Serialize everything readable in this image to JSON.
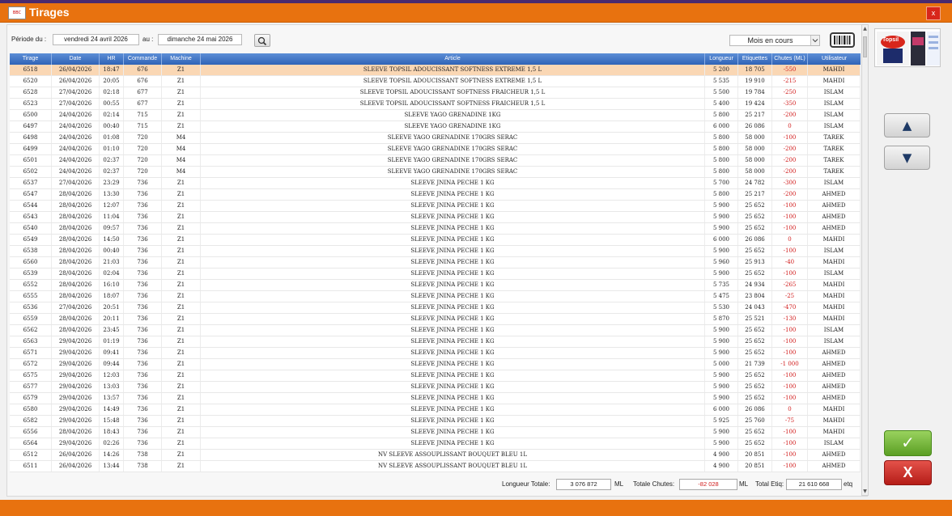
{
  "window": {
    "title": "Tirages",
    "close_label": "x",
    "logo_text": "BBC"
  },
  "filters": {
    "periode_label": "Période du :",
    "date_from": "vendredi 24 avril 2026",
    "au_label": "au :",
    "date_to": "dimanche 24 mai 2026",
    "period_select": "Mois en cours"
  },
  "table": {
    "columns": [
      "Tirage",
      "Date",
      "HR",
      "Commande",
      "Machine",
      "Article",
      "Longueur",
      "Etiquettes",
      "Chutes (ML)",
      "Utilisateur"
    ],
    "rows": [
      [
        "6518",
        "26/04/2026",
        "18:47",
        "676",
        "Z1",
        "SLEEVE TOPSIL ADOUCISSANT SOFTNESS EXTREME 1,5 L",
        "5 200",
        "18 705",
        "-550",
        "MAHDI"
      ],
      [
        "6520",
        "26/04/2026",
        "20:05",
        "676",
        "Z1",
        "SLEEVE TOPSIL ADOUCISSANT SOFTNESS EXTREME 1,5 L",
        "5 535",
        "19 910",
        "-215",
        "MAHDI"
      ],
      [
        "6528",
        "27/04/2026",
        "02:18",
        "677",
        "Z1",
        "SLEEVE TOPSIL ADOUCISSANT SOFTNESS FRAICHEUR 1,5 L",
        "5 500",
        "19 784",
        "-250",
        "ISLAM"
      ],
      [
        "6523",
        "27/04/2026",
        "00:55",
        "677",
        "Z1",
        "SLEEVE TOPSIL ADOUCISSANT SOFTNESS FRAICHEUR 1,5 L",
        "5 400",
        "19 424",
        "-350",
        "ISLAM"
      ],
      [
        "6500",
        "24/04/2026",
        "02:14",
        "715",
        "Z1",
        "SLEEVE YAGO GRENADINE 1KG",
        "5 800",
        "25 217",
        "-200",
        "ISLAM"
      ],
      [
        "6497",
        "24/04/2026",
        "00:40",
        "715",
        "Z1",
        "SLEEVE YAGO GRENADINE 1KG",
        "6 000",
        "26 086",
        "0",
        "ISLAM"
      ],
      [
        "6498",
        "24/04/2026",
        "01:08",
        "720",
        "M4",
        "SLEEVE YAGO GRENADINE 170GRS SERAC",
        "5 800",
        "58 000",
        "-100",
        "TAREK"
      ],
      [
        "6499",
        "24/04/2026",
        "01:10",
        "720",
        "M4",
        "SLEEVE YAGO GRENADINE 170GRS SERAC",
        "5 800",
        "58 000",
        "-200",
        "TAREK"
      ],
      [
        "6501",
        "24/04/2026",
        "02:37",
        "720",
        "M4",
        "SLEEVE YAGO GRENADINE 170GRS SERAC",
        "5 800",
        "58 000",
        "-200",
        "TAREK"
      ],
      [
        "6502",
        "24/04/2026",
        "02:37",
        "720",
        "M4",
        "SLEEVE YAGO GRENADINE 170GRS SERAC",
        "5 800",
        "58 000",
        "-200",
        "TAREK"
      ],
      [
        "6537",
        "27/04/2026",
        "23:29",
        "736",
        "Z1",
        "SLEEVE JNINA PECHE 1 KG",
        "5 700",
        "24 782",
        "-300",
        "ISLAM"
      ],
      [
        "6547",
        "28/04/2026",
        "13:30",
        "736",
        "Z1",
        "SLEEVE JNINA PECHE 1 KG",
        "5 800",
        "25 217",
        "-200",
        "AHMED"
      ],
      [
        "6544",
        "28/04/2026",
        "12:07",
        "736",
        "Z1",
        "SLEEVE JNINA PECHE 1 KG",
        "5 900",
        "25 652",
        "-100",
        "AHMED"
      ],
      [
        "6543",
        "28/04/2026",
        "11:04",
        "736",
        "Z1",
        "SLEEVE JNINA PECHE 1 KG",
        "5 900",
        "25 652",
        "-100",
        "AHMED"
      ],
      [
        "6540",
        "28/04/2026",
        "09:57",
        "736",
        "Z1",
        "SLEEVE JNINA PECHE 1 KG",
        "5 900",
        "25 652",
        "-100",
        "AHMED"
      ],
      [
        "6549",
        "28/04/2026",
        "14:50",
        "736",
        "Z1",
        "SLEEVE JNINA PECHE 1 KG",
        "6 000",
        "26 086",
        "0",
        "MAHDI"
      ],
      [
        "6538",
        "28/04/2026",
        "00:40",
        "736",
        "Z1",
        "SLEEVE JNINA PECHE 1 KG",
        "5 900",
        "25 652",
        "-100",
        "ISLAM"
      ],
      [
        "6560",
        "28/04/2026",
        "21:03",
        "736",
        "Z1",
        "SLEEVE JNINA PECHE 1 KG",
        "5 960",
        "25 913",
        "-40",
        "MAHDI"
      ],
      [
        "6539",
        "28/04/2026",
        "02:04",
        "736",
        "Z1",
        "SLEEVE JNINA PECHE 1 KG",
        "5 900",
        "25 652",
        "-100",
        "ISLAM"
      ],
      [
        "6552",
        "28/04/2026",
        "16:10",
        "736",
        "Z1",
        "SLEEVE JNINA PECHE 1 KG",
        "5 735",
        "24 934",
        "-265",
        "MAHDI"
      ],
      [
        "6555",
        "28/04/2026",
        "18:07",
        "736",
        "Z1",
        "SLEEVE JNINA PECHE 1 KG",
        "5 475",
        "23 804",
        "-25",
        "MAHDI"
      ],
      [
        "6536",
        "27/04/2026",
        "20:51",
        "736",
        "Z1",
        "SLEEVE JNINA PECHE 1 KG",
        "5 530",
        "24 043",
        "-470",
        "MAHDI"
      ],
      [
        "6559",
        "28/04/2026",
        "20:11",
        "736",
        "Z1",
        "SLEEVE JNINA PECHE 1 KG",
        "5 870",
        "25 521",
        "-130",
        "MAHDI"
      ],
      [
        "6562",
        "28/04/2026",
        "23:45",
        "736",
        "Z1",
        "SLEEVE JNINA PECHE 1 KG",
        "5 900",
        "25 652",
        "-100",
        "ISLAM"
      ],
      [
        "6563",
        "29/04/2026",
        "01:19",
        "736",
        "Z1",
        "SLEEVE JNINA PECHE 1 KG",
        "5 900",
        "25 652",
        "-100",
        "ISLAM"
      ],
      [
        "6571",
        "29/04/2026",
        "09:41",
        "736",
        "Z1",
        "SLEEVE JNINA PECHE 1 KG",
        "5 900",
        "25 652",
        "-100",
        "AHMED"
      ],
      [
        "6572",
        "29/04/2026",
        "09:44",
        "736",
        "Z1",
        "SLEEVE JNINA PECHE 1 KG",
        "5 000",
        "21 739",
        "-1 000",
        "AHMED"
      ],
      [
        "6575",
        "29/04/2026",
        "12:03",
        "736",
        "Z1",
        "SLEEVE JNINA PECHE 1 KG",
        "5 900",
        "25 652",
        "-100",
        "AHMED"
      ],
      [
        "6577",
        "29/04/2026",
        "13:03",
        "736",
        "Z1",
        "SLEEVE JNINA PECHE 1 KG",
        "5 900",
        "25 652",
        "-100",
        "AHMED"
      ],
      [
        "6579",
        "29/04/2026",
        "13:57",
        "736",
        "Z1",
        "SLEEVE JNINA PECHE 1 KG",
        "5 900",
        "25 652",
        "-100",
        "AHMED"
      ],
      [
        "6580",
        "29/04/2026",
        "14:49",
        "736",
        "Z1",
        "SLEEVE JNINA PECHE 1 KG",
        "6 000",
        "26 086",
        "0",
        "MAHDI"
      ],
      [
        "6582",
        "29/04/2026",
        "15:48",
        "736",
        "Z1",
        "SLEEVE JNINA PECHE 1 KG",
        "5 925",
        "25 760",
        "-75",
        "MAHDI"
      ],
      [
        "6556",
        "28/04/2026",
        "18:43",
        "736",
        "Z1",
        "SLEEVE JNINA PECHE 1 KG",
        "5 900",
        "25 652",
        "-100",
        "MAHDI"
      ],
      [
        "6564",
        "29/04/2026",
        "02:26",
        "736",
        "Z1",
        "SLEEVE JNINA PECHE 1 KG",
        "5 900",
        "25 652",
        "-100",
        "ISLAM"
      ],
      [
        "6512",
        "26/04/2026",
        "14:26",
        "738",
        "Z1",
        "NV SLEEVE ASSOUPLISSANT BOUQUET BLEU 1L",
        "4 900",
        "20 851",
        "-100",
        "AHMED"
      ],
      [
        "6511",
        "26/04/2026",
        "13:44",
        "738",
        "Z1",
        "NV SLEEVE ASSOUPLISSANT BOUQUET BLEU 1L",
        "4 900",
        "20 851",
        "-100",
        "AHMED"
      ]
    ]
  },
  "totals": {
    "longueur_label": "Longueur Totale:",
    "longueur_value": "3 076 872",
    "longueur_unit": "ML",
    "chutes_label": "Totale Chutes:",
    "chutes_value": "-82 028",
    "chutes_unit": "ML",
    "etiq_label": "Total Etiq:",
    "etiq_value": "21 610 668",
    "etiq_unit": "etq"
  },
  "side": {
    "thumbnail_text": "Topsil",
    "up_icon": "▲",
    "down_icon": "▼",
    "ok_icon": "✓",
    "cancel_label": "X"
  },
  "colors": {
    "accent": "#e8720f",
    "header": "#3b6fc2",
    "selected_row": "#fad7b4",
    "negative": "#d11c1c"
  }
}
